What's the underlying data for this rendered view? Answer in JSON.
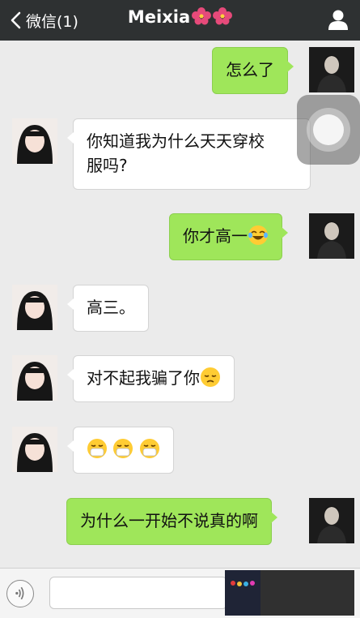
{
  "header": {
    "back_label": "微信(1)",
    "title": "Meixia",
    "title_icons": [
      "hibiscus-icon",
      "hibiscus-icon"
    ],
    "right_icon": "person-icon"
  },
  "messages": [
    {
      "sender": "me",
      "text": "怎么了"
    },
    {
      "sender": "her",
      "text": "你知道我为什么天天穿校\n服吗?"
    },
    {
      "sender": "me",
      "text": "你才高一",
      "emoji": "tears-of-joy-emoji"
    },
    {
      "sender": "her",
      "text": "高三。"
    },
    {
      "sender": "her",
      "text": "对不起我骗了你",
      "emoji": "pensive-emoji"
    },
    {
      "sender": "her",
      "text": "",
      "emoji": "mask-emoji x3"
    },
    {
      "sender": "me",
      "text": "为什么一开始不说真的啊"
    }
  ],
  "input_bar": {
    "voice_icon": "voice-icon",
    "placeholder": ""
  },
  "colors": {
    "header_bg": "#2e3132",
    "chat_bg": "#ebebeb",
    "my_bubble": "#9fe65a",
    "her_bubble": "#ffffff"
  }
}
